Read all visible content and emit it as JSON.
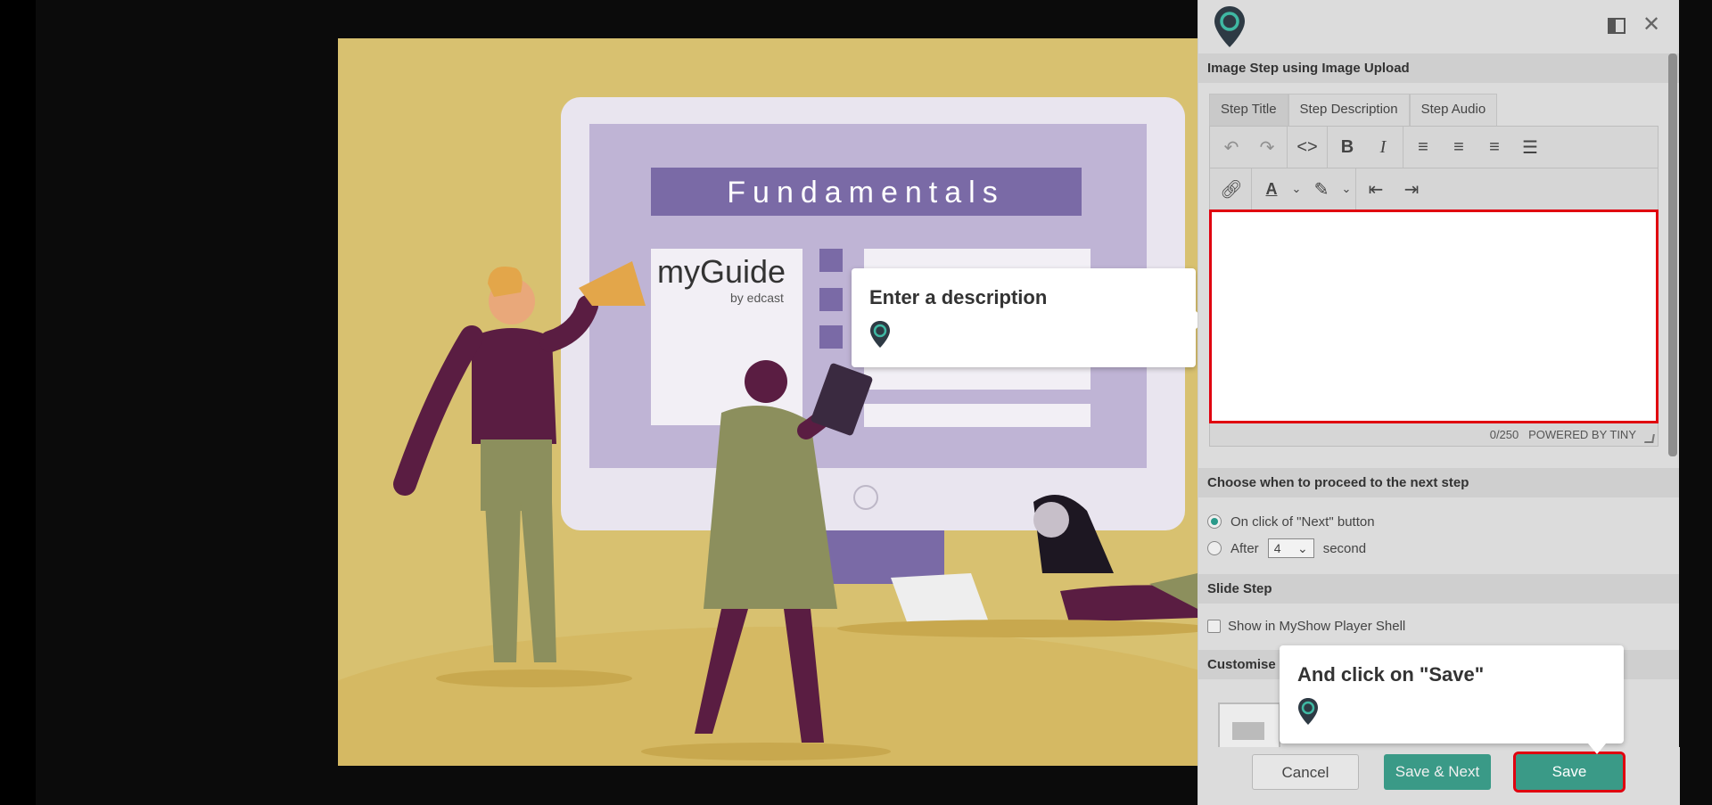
{
  "slide": {
    "banner_title": "Fundamentals",
    "logo_text": "myGuide",
    "logo_sub": "by edcast"
  },
  "panel": {
    "section_title": "Image Step using Image Upload",
    "tabs": [
      "Step Title",
      "Step Description",
      "Step Audio"
    ],
    "active_tab": "Step Title",
    "editor_counter": "0/250",
    "editor_powered": "POWERED BY TINY",
    "proceed_section": "Choose when to proceed to the next step",
    "option_next": "On click of \"Next\" button",
    "option_after": "After",
    "after_value": "4",
    "after_unit": "second",
    "slide_section": "Slide Step",
    "show_in_player": "Show in MyShow Player Shell",
    "customise_section": "Customise",
    "cancel_label": "Cancel",
    "save_next_label": "Save & Next",
    "save_label": "Save"
  },
  "tooltips": {
    "desc_text": "Enter a description",
    "save_text": "And click on \"Save\""
  },
  "colors": {
    "accent": "#3a9a87",
    "highlight": "#e0000f",
    "slide_bg": "#d8c170",
    "banner": "#7a6aa6",
    "plum": "#5a1d42",
    "olive": "#8c8f5d"
  }
}
